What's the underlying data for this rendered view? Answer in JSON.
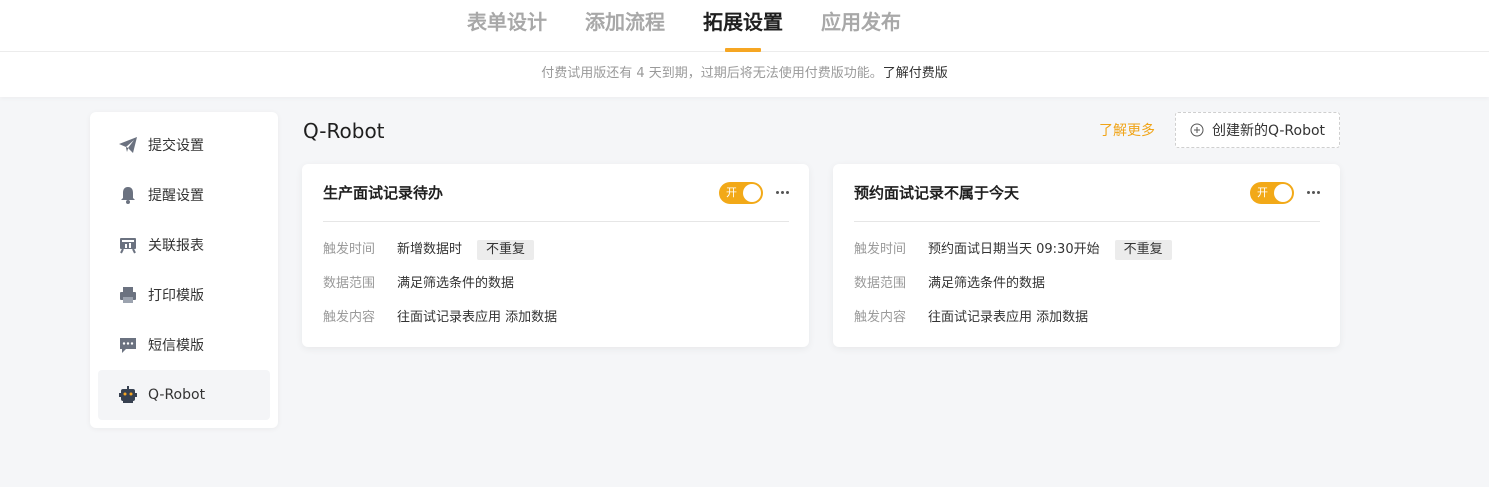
{
  "tabs": [
    {
      "label": "表单设计",
      "active": false
    },
    {
      "label": "添加流程",
      "active": false
    },
    {
      "label": "拓展设置",
      "active": true
    },
    {
      "label": "应用发布",
      "active": false
    }
  ],
  "notice": {
    "text": "付费试用版还有 4 天到期，过期后将无法使用付费版功能。",
    "link": "了解付费版"
  },
  "sidebar": {
    "items": [
      {
        "label": "提交设置",
        "icon": "paper-plane-icon",
        "active": false
      },
      {
        "label": "提醒设置",
        "icon": "bell-icon",
        "active": false
      },
      {
        "label": "关联报表",
        "icon": "report-icon",
        "active": false
      },
      {
        "label": "打印模版",
        "icon": "printer-icon",
        "active": false
      },
      {
        "label": "短信模版",
        "icon": "message-icon",
        "active": false
      },
      {
        "label": "Q-Robot",
        "icon": "robot-icon",
        "active": true
      }
    ]
  },
  "main": {
    "title": "Q-Robot",
    "learn_more": "了解更多",
    "create_button": "创建新的Q-Robot"
  },
  "cards": [
    {
      "title": "生产面试记录待办",
      "toggle_label": "开",
      "rows": [
        {
          "label": "触发时间",
          "value": "新增数据时",
          "tag": "不重复"
        },
        {
          "label": "数据范围",
          "value": "满足筛选条件的数据"
        },
        {
          "label": "触发内容",
          "value": "往面试记录表应用 添加数据"
        }
      ]
    },
    {
      "title": "预约面试记录不属于今天",
      "toggle_label": "开",
      "rows": [
        {
          "label": "触发时间",
          "value": "预约面试日期当天 09:30开始",
          "tag": "不重复"
        },
        {
          "label": "数据范围",
          "value": "满足筛选条件的数据"
        },
        {
          "label": "触发内容",
          "value": "往面试记录表应用 添加数据"
        }
      ]
    }
  ],
  "colors": {
    "accent": "#f6a623",
    "toggle_on": "#f2a918",
    "link": "#f0a418"
  }
}
